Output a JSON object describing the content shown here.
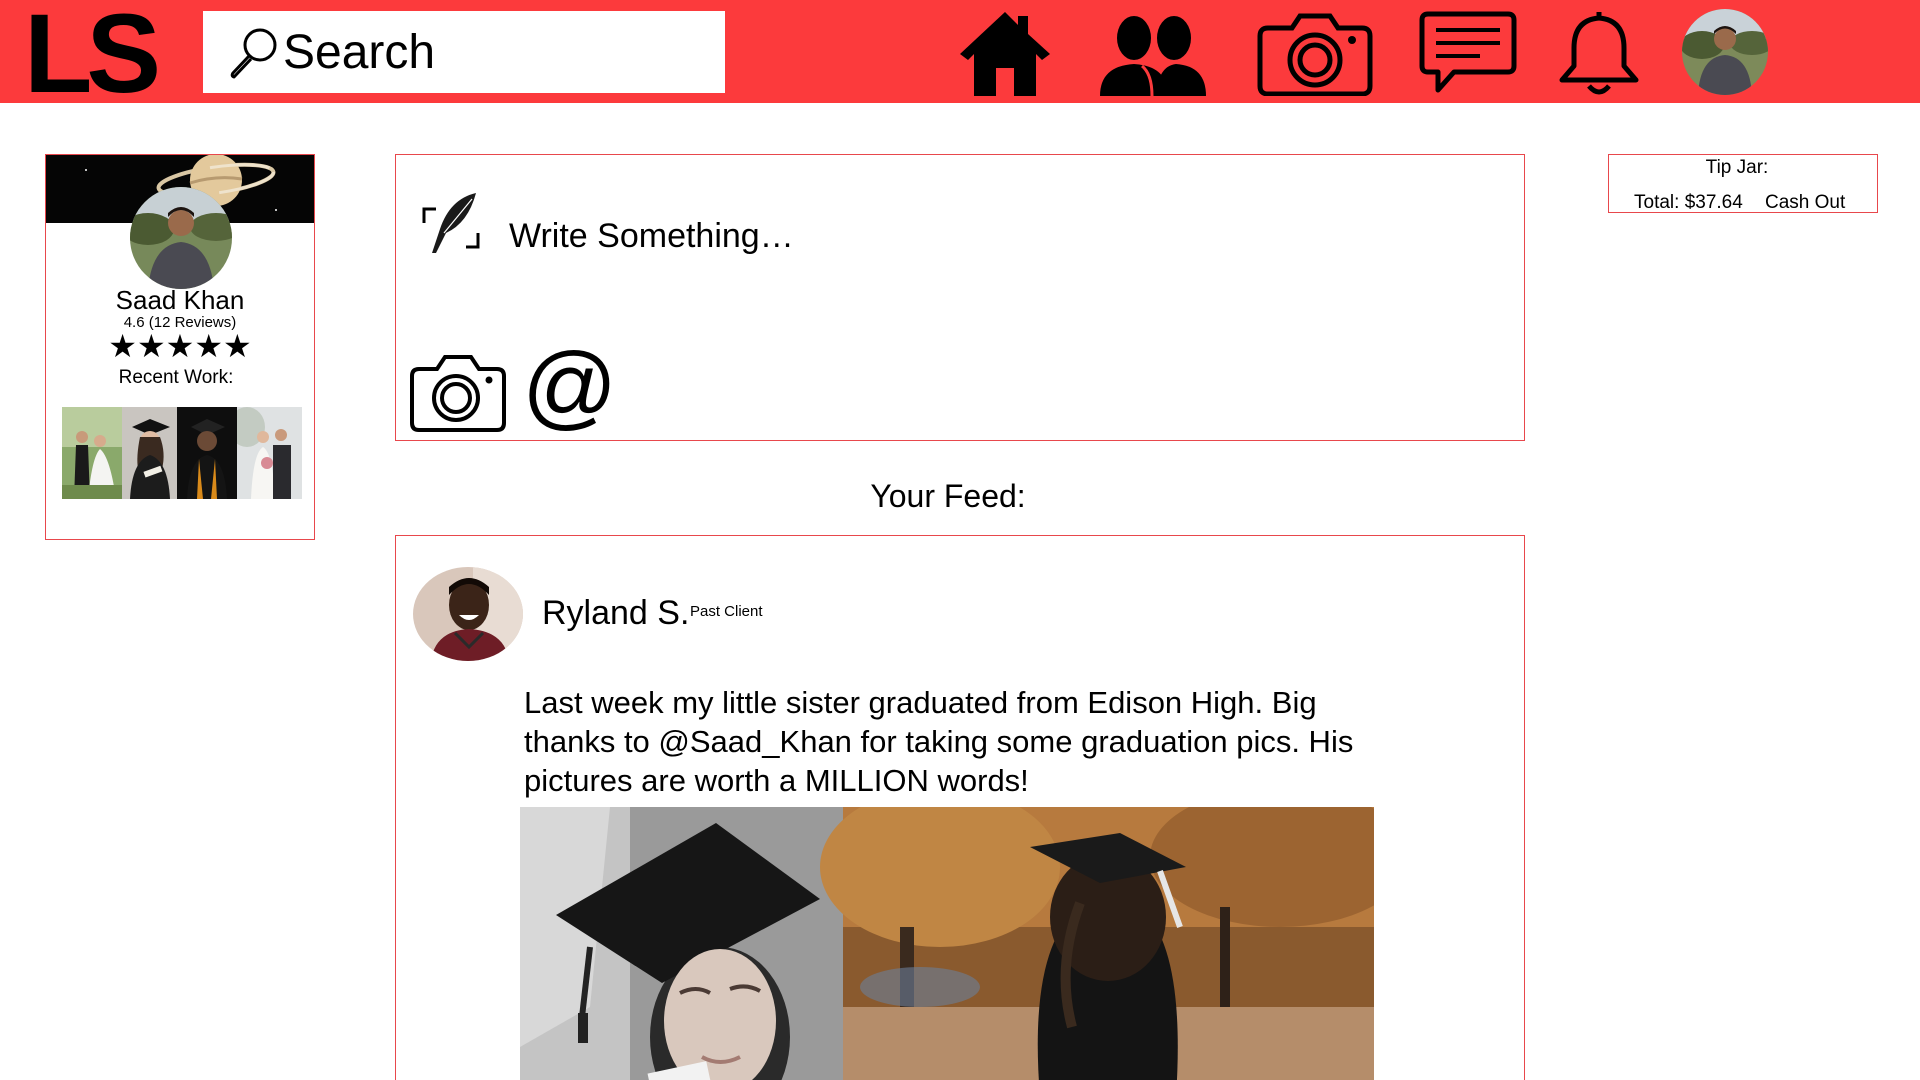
{
  "header": {
    "logo": "LS",
    "search_placeholder": "Search",
    "nav": [
      "home-icon",
      "friends-icon",
      "camera-icon",
      "messages-icon",
      "notifications-icon",
      "user-avatar"
    ],
    "accent_color": "#fc3a3c"
  },
  "profile": {
    "name": "Saad Khan",
    "rating": "4.6 (12 Reviews)",
    "stars": "★★★★★",
    "star_value": 4.6,
    "recent_work_label": "Recent Work:"
  },
  "tip_jar": {
    "title": "Tip Jar:",
    "total": "Total: $37.64",
    "cash_out": "Cash Out"
  },
  "composer": {
    "placeholder": "Write Something…",
    "at_symbol": "@"
  },
  "feed": {
    "title": "Your Feed:",
    "posts": [
      {
        "author": "Ryland S.",
        "role": "Past Client",
        "text": "Last week my little sister graduated from Edison High. Big thanks to @Saad_Khan for taking some graduation pics. His pictures are worth a MILLION words!"
      }
    ]
  }
}
